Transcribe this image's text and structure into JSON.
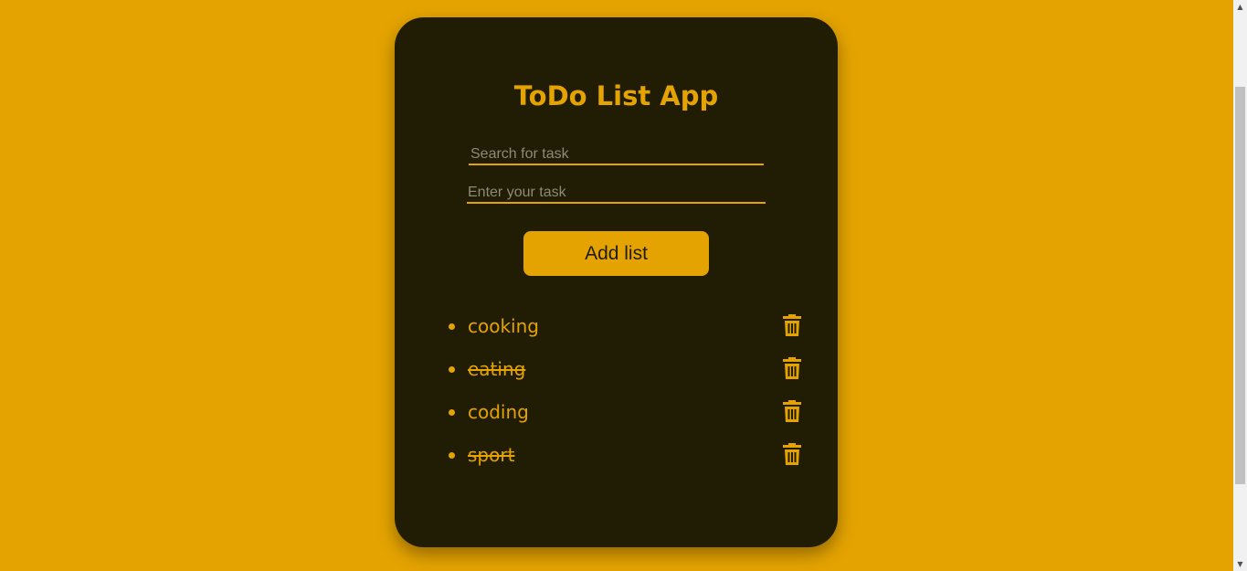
{
  "app": {
    "title": "ToDo List App"
  },
  "search": {
    "placeholder": "Search for task",
    "value": ""
  },
  "task_input": {
    "placeholder": "Enter your task",
    "value": ""
  },
  "add_button": {
    "label": "Add list"
  },
  "tasks": [
    {
      "label": "cooking",
      "completed": false
    },
    {
      "label": "eating",
      "completed": true
    },
    {
      "label": "coding",
      "completed": false
    },
    {
      "label": "sport",
      "completed": true
    }
  ],
  "icons": {
    "delete": "trash-icon",
    "bullet": "bullet-dot"
  },
  "colors": {
    "background": "#e4a300",
    "card": "#201d04",
    "accent": "#e4a300",
    "placeholder": "#8d8a76"
  },
  "scrollbar": {
    "up_glyph": "▲",
    "down_glyph": "▼"
  }
}
